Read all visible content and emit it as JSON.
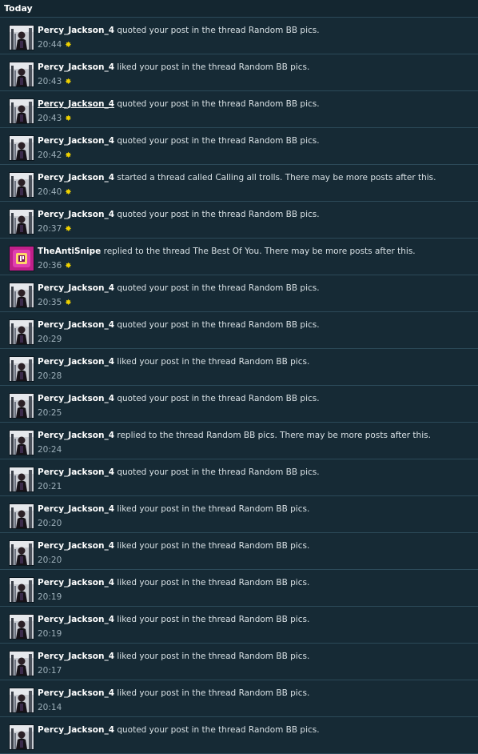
{
  "header": {
    "title": "Today"
  },
  "notifications": [
    {
      "user": "Percy_Jackson_4",
      "avatar": "percy",
      "pre": " quoted your post in the thread ",
      "thread": "Random BB pics",
      "post": ".",
      "time": "20:44",
      "unread": true
    },
    {
      "user": "Percy_Jackson_4",
      "avatar": "percy",
      "pre": " liked your post in the thread ",
      "thread": "Random BB pics",
      "post": ".",
      "time": "20:43",
      "unread": true
    },
    {
      "user": "Percy_Jackson_4",
      "avatar": "percy",
      "pre": " quoted your post in the thread ",
      "thread": "Random BB pics",
      "post": ".",
      "time": "20:43",
      "unread": true,
      "underline": true
    },
    {
      "user": "Percy_Jackson_4",
      "avatar": "percy",
      "pre": " quoted your post in the thread ",
      "thread": "Random BB pics",
      "post": ".",
      "time": "20:42",
      "unread": true
    },
    {
      "user": "Percy_Jackson_4",
      "avatar": "percy",
      "pre": " started a thread called ",
      "thread": "Calling all trolls",
      "post": ". There may be more posts after this.",
      "time": "20:40",
      "unread": true
    },
    {
      "user": "Percy_Jackson_4",
      "avatar": "percy",
      "pre": " quoted your post in the thread ",
      "thread": "Random BB pics",
      "post": ".",
      "time": "20:37",
      "unread": true
    },
    {
      "user": "TheAntiSnipe",
      "avatar": "snipe",
      "pre": " replied to the thread ",
      "thread": "The Best Of You",
      "post": ". There may be more posts after this.",
      "time": "20:36",
      "unread": true
    },
    {
      "user": "Percy_Jackson_4",
      "avatar": "percy",
      "pre": " quoted your post in the thread ",
      "thread": "Random BB pics",
      "post": ".",
      "time": "20:35",
      "unread": true
    },
    {
      "user": "Percy_Jackson_4",
      "avatar": "percy",
      "pre": " quoted your post in the thread ",
      "thread": "Random BB pics",
      "post": ".",
      "time": "20:29",
      "unread": false
    },
    {
      "user": "Percy_Jackson_4",
      "avatar": "percy",
      "pre": " liked your post in the thread ",
      "thread": "Random BB pics",
      "post": ".",
      "time": "20:28",
      "unread": false
    },
    {
      "user": "Percy_Jackson_4",
      "avatar": "percy",
      "pre": " quoted your post in the thread ",
      "thread": "Random BB pics",
      "post": ".",
      "time": "20:25",
      "unread": false
    },
    {
      "user": "Percy_Jackson_4",
      "avatar": "percy",
      "pre": " replied to the thread ",
      "thread": "Random BB pics",
      "post": ". There may be more posts after this.",
      "time": "20:24",
      "unread": false
    },
    {
      "user": "Percy_Jackson_4",
      "avatar": "percy",
      "pre": " quoted your post in the thread ",
      "thread": "Random BB pics",
      "post": ".",
      "time": "20:21",
      "unread": false
    },
    {
      "user": "Percy_Jackson_4",
      "avatar": "percy",
      "pre": " liked your post in the thread ",
      "thread": "Random BB pics",
      "post": ".",
      "time": "20:20",
      "unread": false
    },
    {
      "user": "Percy_Jackson_4",
      "avatar": "percy",
      "pre": " liked your post in the thread ",
      "thread": "Random BB pics",
      "post": ".",
      "time": "20:20",
      "unread": false
    },
    {
      "user": "Percy_Jackson_4",
      "avatar": "percy",
      "pre": " liked your post in the thread ",
      "thread": "Random BB pics",
      "post": ".",
      "time": "20:19",
      "unread": false
    },
    {
      "user": "Percy_Jackson_4",
      "avatar": "percy",
      "pre": " liked your post in the thread ",
      "thread": "Random BB pics",
      "post": ".",
      "time": "20:19",
      "unread": false
    },
    {
      "user": "Percy_Jackson_4",
      "avatar": "percy",
      "pre": " liked your post in the thread ",
      "thread": "Random BB pics",
      "post": ".",
      "time": "20:17",
      "unread": false
    },
    {
      "user": "Percy_Jackson_4",
      "avatar": "percy",
      "pre": " liked your post in the thread ",
      "thread": "Random BB pics",
      "post": ".",
      "time": "20:14",
      "unread": false
    },
    {
      "user": "Percy_Jackson_4",
      "avatar": "percy",
      "pre": " quoted your post in the thread ",
      "thread": "Random BB pics",
      "post": ".",
      "time": "",
      "unread": false
    }
  ],
  "unread_marker": "✸",
  "colors": {
    "background": "#162a35",
    "divider": "#2c4a59",
    "unread_star": "#f0d200",
    "time": "#9eb0ba"
  }
}
